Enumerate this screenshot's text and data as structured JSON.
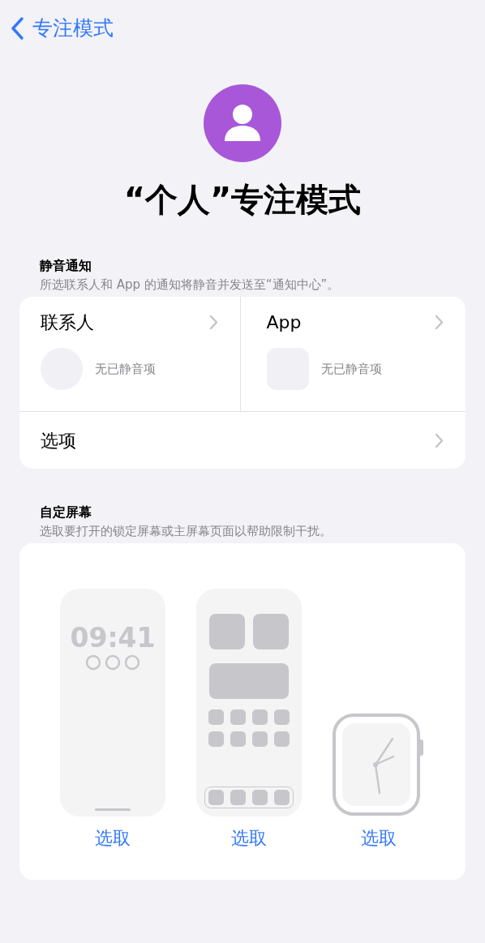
{
  "nav": {
    "back_label": "专注模式"
  },
  "title": "“个人”专注模式",
  "silence": {
    "header": "静音通知",
    "description": "所选联系人和 App 的通知将静音并发送至“通知中心”。",
    "panes": [
      {
        "kind": "people",
        "label": "联系人",
        "empty": "无已静音项"
      },
      {
        "kind": "apps",
        "label": "App",
        "empty": "无已静音项"
      }
    ],
    "options": "选项"
  },
  "screens": {
    "header": "自定屏幕",
    "description": "选取要打开的锁定屏幕或主屏幕页面以帮助限制干扰。",
    "items": [
      {
        "kind": "lock",
        "time": "09:41",
        "action": "选取"
      },
      {
        "kind": "home",
        "action": "选取"
      },
      {
        "kind": "watch",
        "action": "选取"
      }
    ]
  }
}
